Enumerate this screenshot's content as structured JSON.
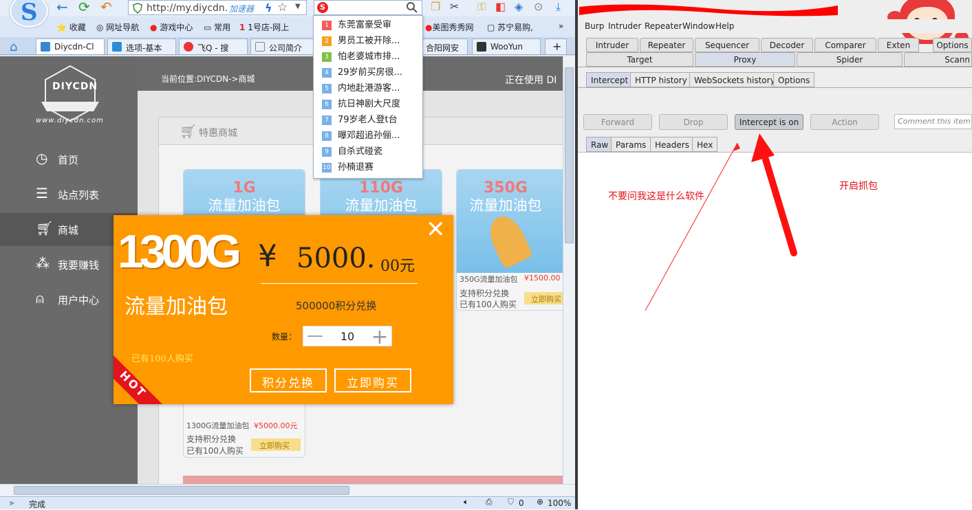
{
  "browser": {
    "url": "http://my.diycdn.",
    "url_accel": "加速器",
    "bookmarks": [
      "收藏",
      "网址导航",
      "游戏中心",
      "常用",
      "1号店-网上",
      "美图秀秀网",
      "苏宁易购,"
    ],
    "tabs": [
      "Diycdn-Cl",
      "选项-基本",
      "飞Q - 搜",
      "公司简介",
      "合阳网安",
      "WooYun"
    ],
    "suggestions": [
      {
        "n": "1",
        "text": "东莞富豪受审",
        "color": "#f25c5c"
      },
      {
        "n": "2",
        "text": "男员工被开除...",
        "color": "#f5a11e"
      },
      {
        "n": "3",
        "text": "怕老婆城市排...",
        "color": "#7cc04a"
      },
      {
        "n": "4",
        "text": "29岁前买房很...",
        "color": "#7ab0e6"
      },
      {
        "n": "5",
        "text": "内地赴港游客...",
        "color": "#7ab0e6"
      },
      {
        "n": "6",
        "text": "抗日神剧大尺度",
        "color": "#7ab0e6"
      },
      {
        "n": "7",
        "text": "79岁老人登t台",
        "color": "#7ab0e6"
      },
      {
        "n": "8",
        "text": "曝邓超追孙俪...",
        "color": "#7ab0e6"
      },
      {
        "n": "9",
        "text": "自杀式碰瓷",
        "color": "#7ab0e6"
      },
      {
        "n": "10",
        "text": "孙楠退赛",
        "color": "#7ab0e6"
      }
    ],
    "status": {
      "text": "完成",
      "shield_count": "0",
      "zoom": "100%"
    }
  },
  "site": {
    "logo_text": "DIYCDN",
    "logo_url": "www.diycdn.com",
    "breadcrumb": "当前位置:DIYCDN->商城",
    "using": "正在使用  DI",
    "sidebar": [
      "首页",
      "站点列表",
      "商城",
      "我要赚钱",
      "用户中心"
    ],
    "section_title": "特惠商城",
    "cards": [
      {
        "gb": "1G",
        "title": "流量加油包"
      },
      {
        "gb": "110G",
        "title": "流量加油包"
      },
      {
        "gb": "350G",
        "title": "流量加油包",
        "name": "350G流量加油包",
        "price": "¥1500.00",
        "points": "支持积分兑换",
        "sold": "已有100人购买",
        "buy": "立即购买"
      }
    ],
    "bottom_card": {
      "name": "1300G流量加油包",
      "price": "¥5000.00元",
      "points": "支持积分兑换",
      "sold": "已有100人购买",
      "buy": "立即购买"
    }
  },
  "modal": {
    "gb": "1300G",
    "title": "流量加油包",
    "currency": "¥",
    "price_int": "5000.",
    "price_dec": "00元",
    "points": "500000积分兑换",
    "qty_label": "数量：",
    "qty": "10",
    "sold": "已有100人购买",
    "hot": "HOT",
    "btn_points": "积分兑换",
    "btn_buy": "立即购买"
  },
  "burp": {
    "menu": [
      "Burp",
      "Intruder",
      "Repeater",
      "Window",
      "Help"
    ],
    "tabs_row1": [
      "Intruder",
      "Repeater",
      "Sequencer",
      "Decoder",
      "Comparer",
      "Exten",
      "Options"
    ],
    "tabs_row2": [
      "Target",
      "Proxy",
      "Spider",
      "Scann"
    ],
    "proxy_tabs": [
      "Intercept",
      "HTTP history",
      "WebSockets history",
      "Options"
    ],
    "buttons": {
      "forward": "Forward",
      "drop": "Drop",
      "intercept": "Intercept is on",
      "action": "Action",
      "comment": "Comment this item"
    },
    "msg_tabs": [
      "Raw",
      "Params",
      "Headers",
      "Hex"
    ]
  },
  "annotations": {
    "note1": "不要问我这是什么软件",
    "note2": "开启抓包"
  },
  "colors": {
    "accent": "#ff9900",
    "hot": "#e4141b",
    "annotation": "#e0141b"
  }
}
